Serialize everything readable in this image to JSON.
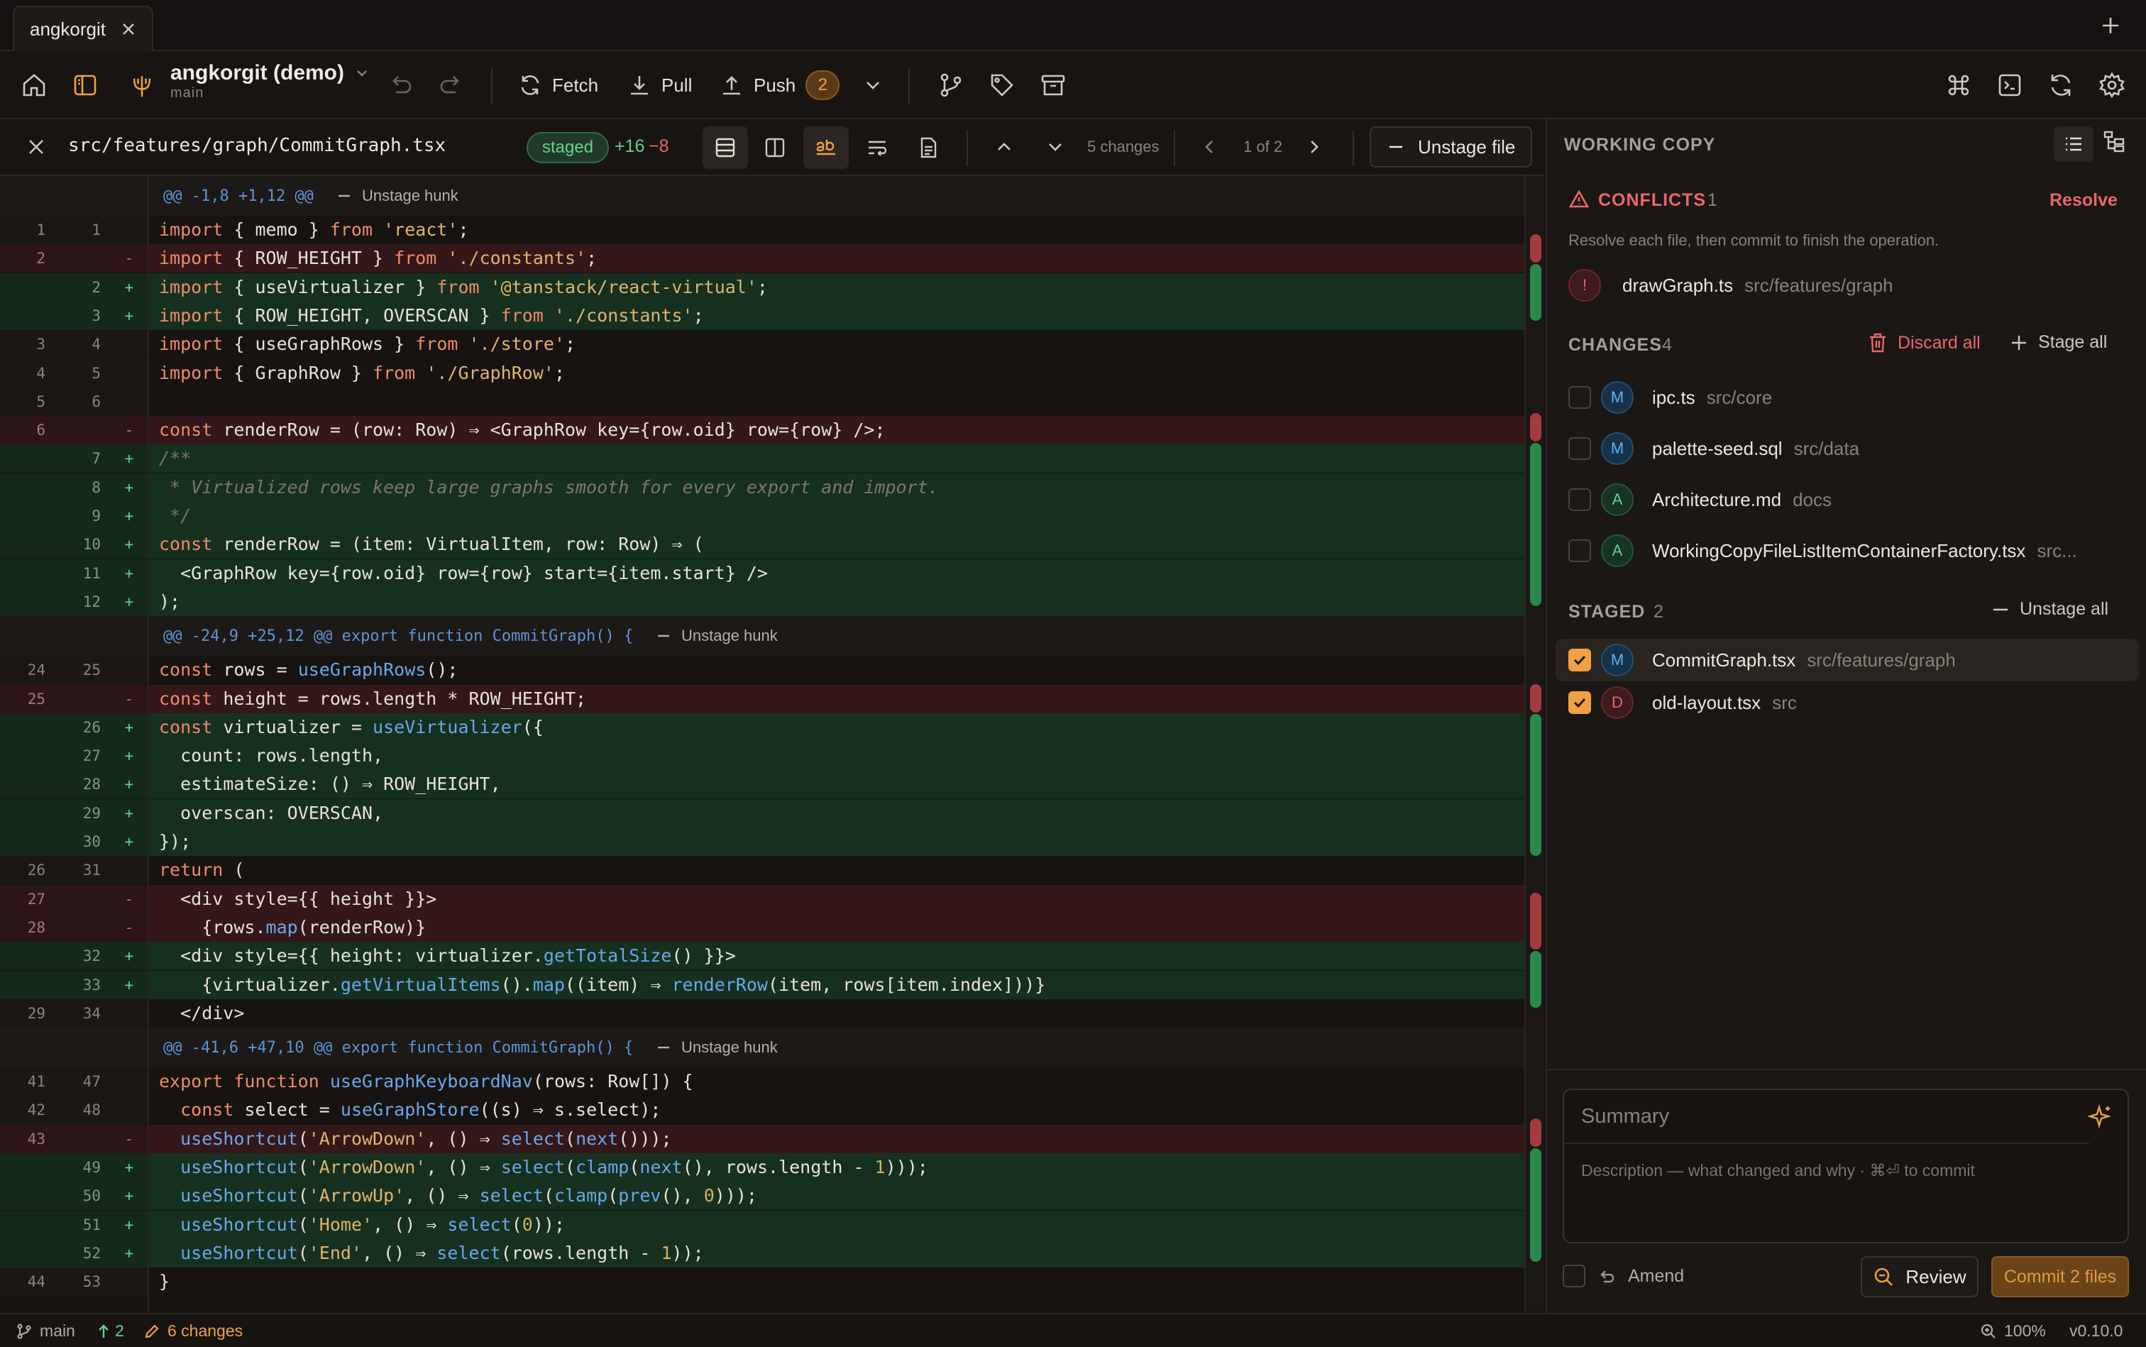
{
  "tab": {
    "title": "angkorgit"
  },
  "toolbar": {
    "repo_name": "angkorgit (demo)",
    "branch": "main",
    "fetch": "Fetch",
    "pull": "Pull",
    "push": "Push",
    "push_count": "2"
  },
  "file_header": {
    "path": "src/features/graph/CommitGraph.tsx",
    "status": "staged",
    "added": "+16",
    "removed": "−8",
    "changes": "5 changes",
    "page": "1 of 2",
    "unstage_file": "Unstage file"
  },
  "diff": {
    "hunks": [
      "@@ -1,8 +1,12 @@",
      "@@ -24,9 +25,12 @@ export function CommitGraph() {",
      "@@ -41,6 +47,10 @@ export function CommitGraph() {"
    ],
    "unstage_hunk": "Unstage hunk",
    "rows": [
      {
        "o": "1",
        "n": "1",
        "m": "",
        "code": "import { memo } from 'react';"
      },
      {
        "o": "2",
        "n": "",
        "m": "-",
        "code": "import { ROW_HEIGHT } from './constants';"
      },
      {
        "o": "",
        "n": "2",
        "m": "+",
        "code": "import { useVirtualizer } from '@tanstack/react-virtual';"
      },
      {
        "o": "",
        "n": "3",
        "m": "+",
        "code": "import { ROW_HEIGHT, OVERSCAN } from './constants';"
      },
      {
        "o": "3",
        "n": "4",
        "m": "",
        "code": "import { useGraphRows } from './store';"
      },
      {
        "o": "4",
        "n": "5",
        "m": "",
        "code": "import { GraphRow } from './GraphRow';"
      },
      {
        "o": "5",
        "n": "6",
        "m": "",
        "code": ""
      },
      {
        "o": "6",
        "n": "",
        "m": "-",
        "code": "const renderRow = (row: Row) ⇒ <GraphRow key={row.oid} row={row} />;"
      },
      {
        "o": "",
        "n": "7",
        "m": "+",
        "code": "/**"
      },
      {
        "o": "",
        "n": "8",
        "m": "+",
        "code": " * Virtualized rows keep large graphs smooth for every export and import."
      },
      {
        "o": "",
        "n": "9",
        "m": "+",
        "code": " */"
      },
      {
        "o": "",
        "n": "10",
        "m": "+",
        "code": "const renderRow = (item: VirtualItem, row: Row) ⇒ ("
      },
      {
        "o": "",
        "n": "11",
        "m": "+",
        "code": "  <GraphRow key={row.oid} row={row} start={item.start} />"
      },
      {
        "o": "",
        "n": "12",
        "m": "+",
        "code": ");"
      },
      {
        "o": "24",
        "n": "25",
        "m": "",
        "code": "const rows = useGraphRows();"
      },
      {
        "o": "25",
        "n": "",
        "m": "-",
        "code": "const height = rows.length * ROW_HEIGHT;"
      },
      {
        "o": "",
        "n": "26",
        "m": "+",
        "code": "const virtualizer = useVirtualizer({"
      },
      {
        "o": "",
        "n": "27",
        "m": "+",
        "code": "  count: rows.length,"
      },
      {
        "o": "",
        "n": "28",
        "m": "+",
        "code": "  estimateSize: () ⇒ ROW_HEIGHT,"
      },
      {
        "o": "",
        "n": "29",
        "m": "+",
        "code": "  overscan: OVERSCAN,"
      },
      {
        "o": "",
        "n": "30",
        "m": "+",
        "code": "});"
      },
      {
        "o": "26",
        "n": "31",
        "m": "",
        "code": "return ("
      },
      {
        "o": "27",
        "n": "",
        "m": "-",
        "code": "  <div style={{ height }}>"
      },
      {
        "o": "28",
        "n": "",
        "m": "-",
        "code": "    {rows.map(renderRow)}"
      },
      {
        "o": "",
        "n": "32",
        "m": "+",
        "code": "  <div style={{ height: virtualizer.getTotalSize() }}>"
      },
      {
        "o": "",
        "n": "33",
        "m": "+",
        "code": "    {virtualizer.getVirtualItems().map((item) ⇒ renderRow(item, rows[item.index]))}"
      },
      {
        "o": "29",
        "n": "34",
        "m": "",
        "code": "  </div>"
      },
      {
        "o": "41",
        "n": "47",
        "m": "",
        "code": "export function useGraphKeyboardNav(rows: Row[]) {"
      },
      {
        "o": "42",
        "n": "48",
        "m": "",
        "code": "  const select = useGraphStore((s) ⇒ s.select);"
      },
      {
        "o": "43",
        "n": "",
        "m": "-",
        "code": "  useShortcut('ArrowDown', () ⇒ select(next()));"
      },
      {
        "o": "",
        "n": "49",
        "m": "+",
        "code": "  useShortcut('ArrowDown', () ⇒ select(clamp(next(), rows.length - 1)));"
      },
      {
        "o": "",
        "n": "50",
        "m": "+",
        "code": "  useShortcut('ArrowUp', () ⇒ select(clamp(prev(), 0)));"
      },
      {
        "o": "",
        "n": "51",
        "m": "+",
        "code": "  useShortcut('Home', () ⇒ select(0));"
      },
      {
        "o": "",
        "n": "52",
        "m": "+",
        "code": "  useShortcut('End', () ⇒ select(rows.length - 1));"
      },
      {
        "o": "44",
        "n": "53",
        "m": "",
        "code": "}"
      }
    ]
  },
  "panel": {
    "title": "WORKING COPY",
    "conflicts": {
      "title": "CONFLICTS",
      "count": "1",
      "resolve": "Resolve",
      "hint": "Resolve each file, then commit to finish the operation.",
      "files": [
        {
          "status": "!",
          "name": "drawGraph.ts",
          "path": "src/features/graph"
        }
      ]
    },
    "changes": {
      "title": "CHANGES",
      "count": "4",
      "discard_all": "Discard all",
      "stage_all": "Stage all",
      "files": [
        {
          "status": "M",
          "name": "ipc.ts",
          "path": "src/core"
        },
        {
          "status": "M",
          "name": "palette-seed.sql",
          "path": "src/data"
        },
        {
          "status": "A",
          "name": "Architecture.md",
          "path": "docs"
        },
        {
          "status": "A",
          "name": "WorkingCopyFileListItemContainerFactory.tsx",
          "path": "src..."
        }
      ]
    },
    "staged": {
      "title": "STAGED",
      "count": "2",
      "unstage_all": "Unstage all",
      "files": [
        {
          "status": "M",
          "name": "CommitGraph.tsx",
          "path": "src/features/graph"
        },
        {
          "status": "D",
          "name": "old-layout.tsx",
          "path": "src"
        }
      ]
    },
    "commit": {
      "summary_placeholder": "Summary",
      "description_placeholder": "Description — what changed and why · ⌘⏎ to commit",
      "amend": "Amend",
      "review": "Review",
      "commit": "Commit 2 files"
    }
  },
  "statusbar": {
    "branch": "main",
    "ahead": "2",
    "changes": "6 changes",
    "zoom": "100%",
    "version": "v0.10.0"
  },
  "colors": {
    "accent": "#f0a142",
    "added": "#5fd18a",
    "removed": "#e06a6a",
    "conflict": "#e8686a"
  }
}
